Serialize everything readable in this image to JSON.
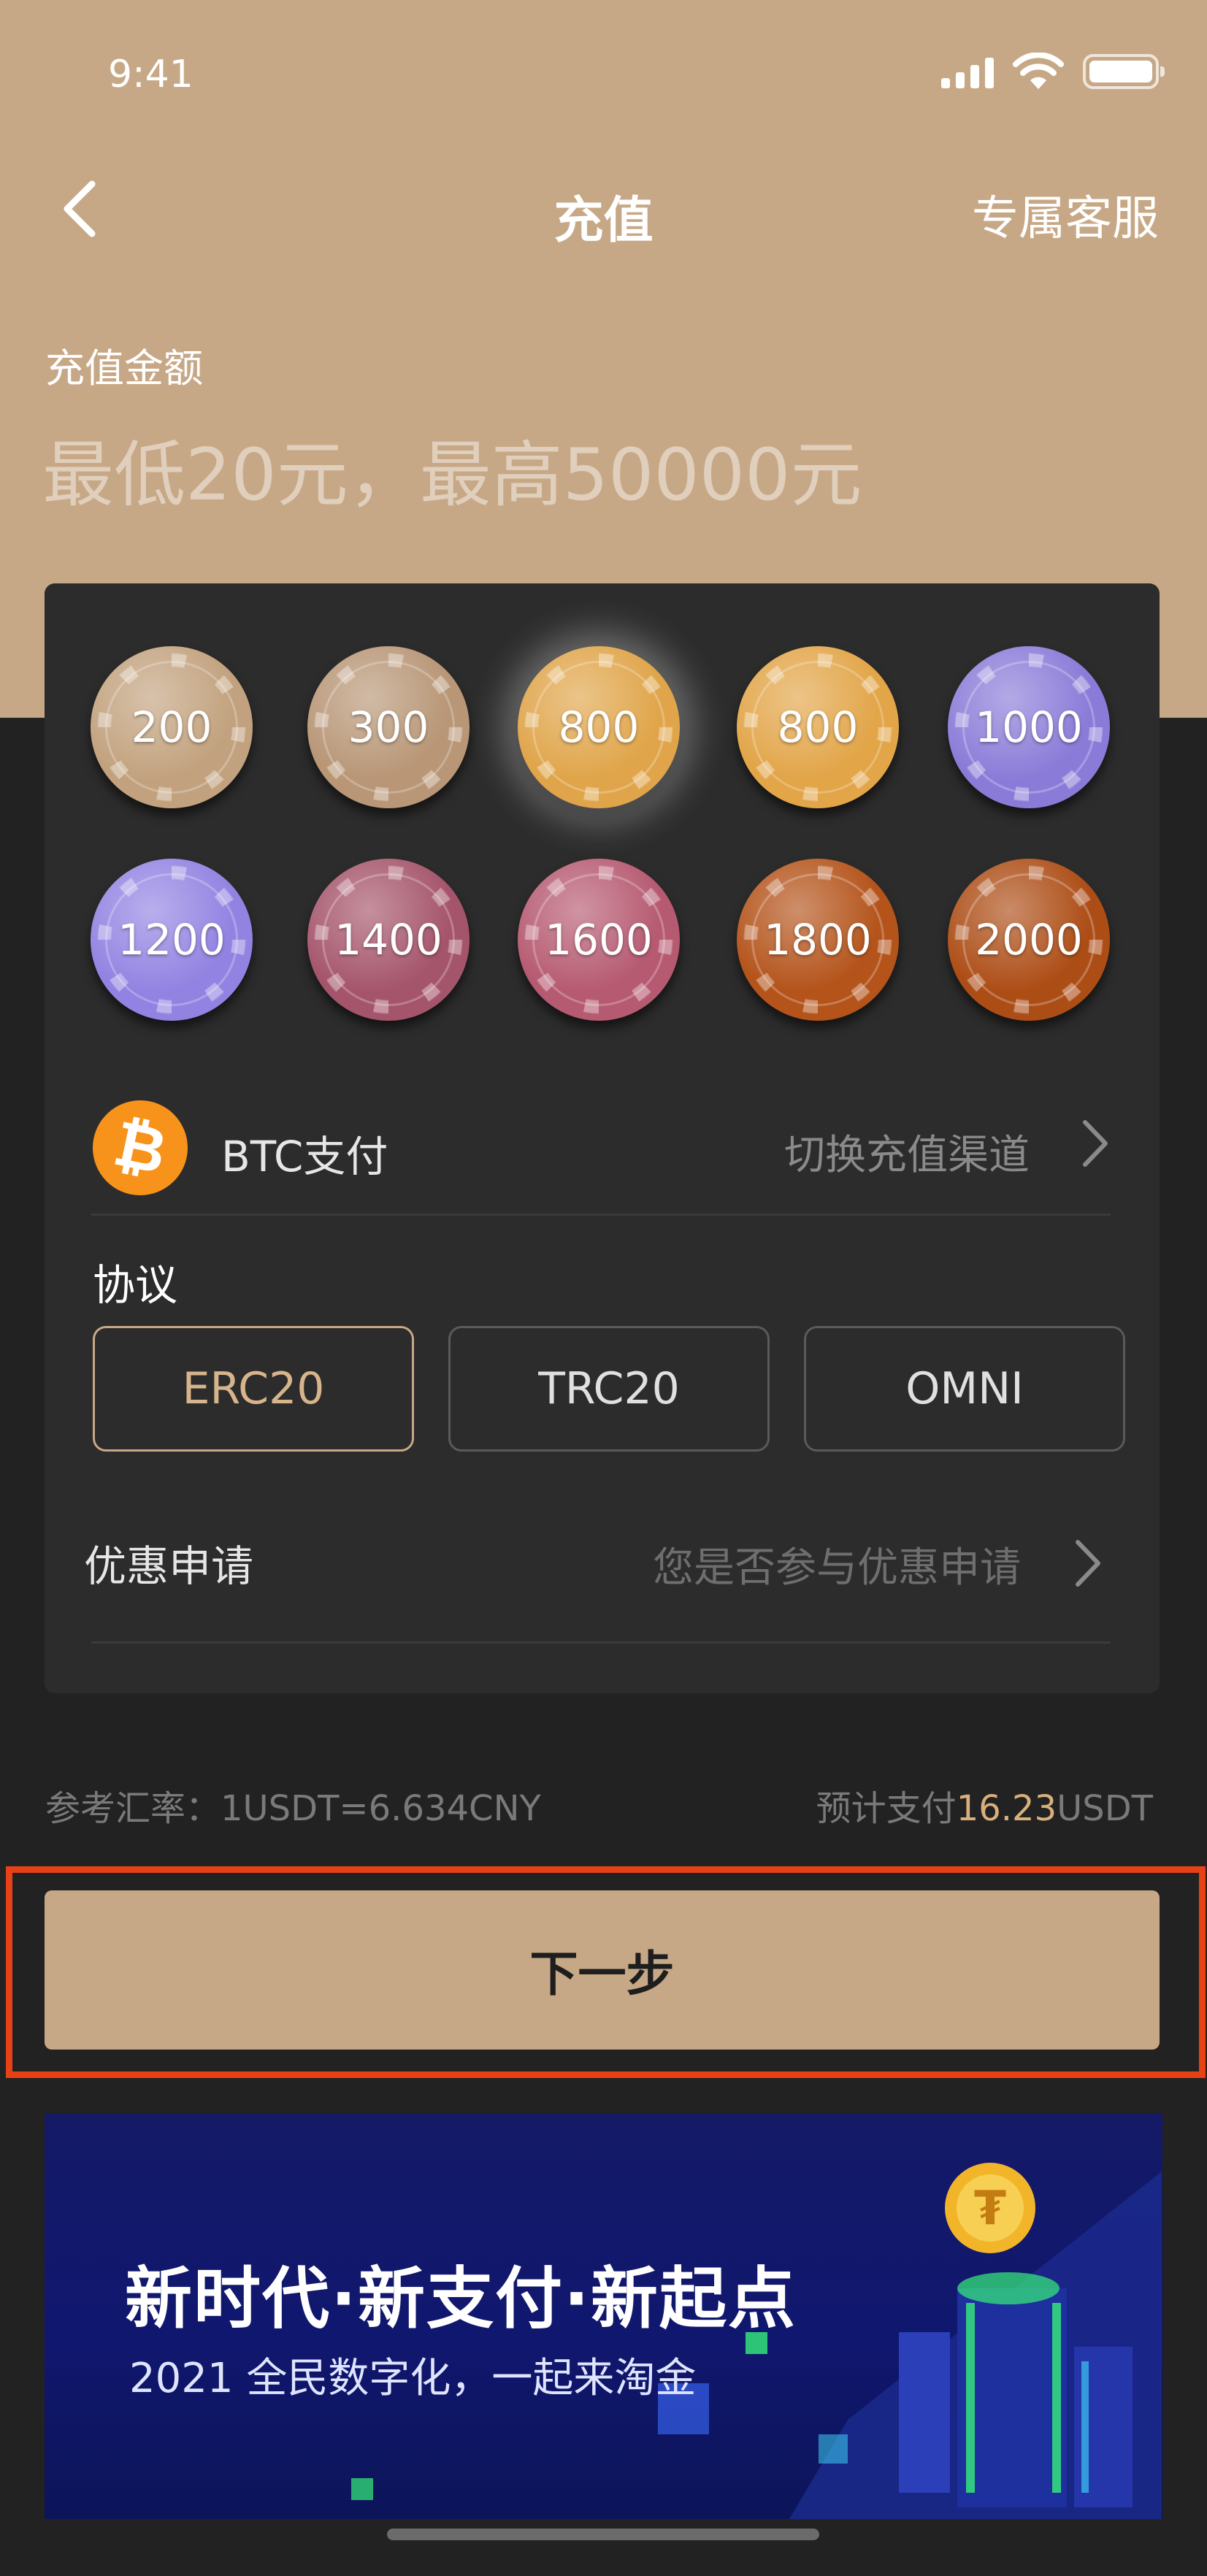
{
  "status_bar": {
    "time": "9:41"
  },
  "nav": {
    "title": "充值",
    "service_label": "专属客服"
  },
  "amount": {
    "label": "充值金额",
    "placeholder": "最低20元，最高50000元"
  },
  "chips": [
    {
      "value": "200",
      "color": "#c2a27e",
      "selected": false
    },
    {
      "value": "300",
      "color": "#b89676",
      "selected": false
    },
    {
      "value": "800",
      "color": "#e0a54a",
      "selected": true
    },
    {
      "value": "800",
      "color": "#e2a548",
      "selected": false
    },
    {
      "value": "1000",
      "color": "#8b7bd8",
      "selected": false
    },
    {
      "value": "1200",
      "color": "#9283e2",
      "selected": false
    },
    {
      "value": "1400",
      "color": "#a5556b",
      "selected": false
    },
    {
      "value": "1600",
      "color": "#b65a71",
      "selected": false
    },
    {
      "value": "1800",
      "color": "#b4531a",
      "selected": false
    },
    {
      "value": "2000",
      "color": "#ad4d16",
      "selected": false
    }
  ],
  "payment": {
    "method": "BTC支付",
    "icon": "bitcoin-icon",
    "switch_label": "切换充值渠道"
  },
  "protocol": {
    "label": "协议",
    "options": [
      "ERC20",
      "TRC20",
      "OMNI"
    ],
    "selected": "ERC20"
  },
  "promotion": {
    "label": "优惠申请",
    "hint": "您是否参与优惠申请"
  },
  "rate": {
    "text": "参考汇率：1USDT=6.634CNY"
  },
  "estimate": {
    "prefix": "预计支付",
    "amount": "16.23",
    "unit": "USDT"
  },
  "next_button": {
    "label": "下一步"
  },
  "banner": {
    "title": "新时代·新支付·新起点",
    "subtitle": "2021 全民数字化，一起来淘金"
  },
  "colors": {
    "accent": "#c7a886",
    "highlight": "#d9b07d",
    "background": "#222222",
    "card": "#2c2c2c",
    "annotation_frame": "#e64216"
  }
}
